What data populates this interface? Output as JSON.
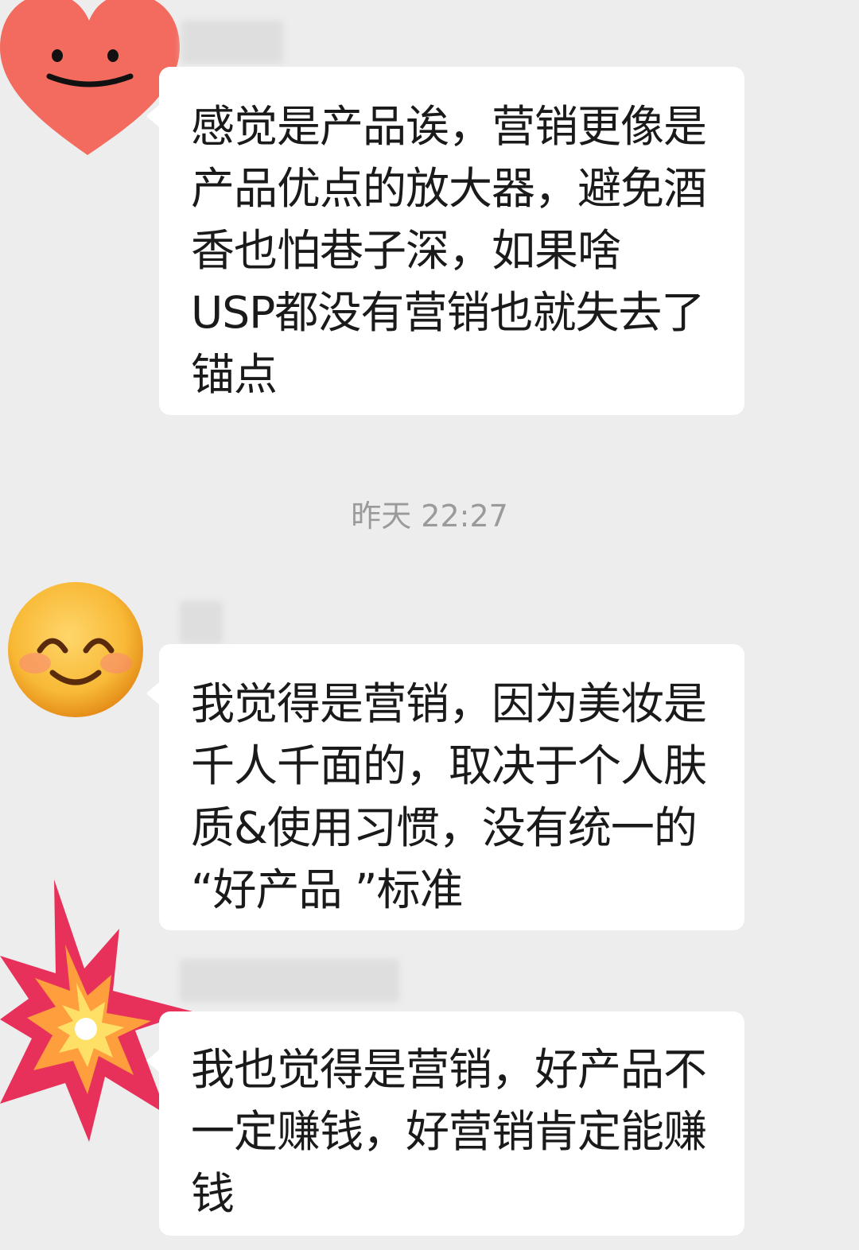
{
  "chat": {
    "timestamp": "昨天 22:27",
    "messages": [
      {
        "avatar_icon": "smiling-heart-icon",
        "text": "感觉是产品诶，营销更像是\n产品优点的放大器，避免酒\n香也怕巷子深，如果啥\nUSP都没有营销也就失去了\n锚点"
      },
      {
        "avatar_icon": "smiling-face-icon",
        "text": "我觉得是营销，因为美妆是\n千人千面的，取决于个人肤\n质&使用习惯，没有统一的\n“好产品 ”标准"
      },
      {
        "avatar_icon": "collision-icon",
        "text": "我也觉得是营销，好产品不\n一定赚钱，好营销肯定能赚\n钱"
      }
    ]
  },
  "colors": {
    "background": "#ededed",
    "bubble": "#ffffff",
    "text": "#1a1a1a",
    "timestamp": "#9a9a9a",
    "heart": "#f36b5f",
    "emoji_face": "#f6b23a"
  }
}
